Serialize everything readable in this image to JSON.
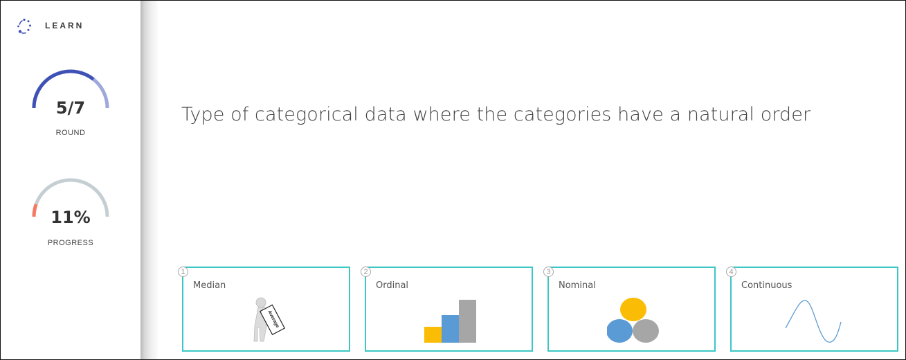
{
  "app": {
    "brand": "LEARN"
  },
  "round": {
    "value": "5/7",
    "label": "ROUND",
    "current": 5,
    "total": 7,
    "color": "#3f51b5",
    "color_light": "#9fa8da"
  },
  "progress": {
    "value": "11%",
    "label": "PROGRESS",
    "fraction": 0.11,
    "color": "#f47a64",
    "track_color": "#c5cfd3"
  },
  "question": {
    "text": "Type of categorical data where the categories have a natural order"
  },
  "options": [
    {
      "num": "1",
      "label": "Median",
      "image": "person-holding-average-sign-icon",
      "sign_text": "Average"
    },
    {
      "num": "2",
      "label": "Ordinal",
      "image": "ascending-bars-icon"
    },
    {
      "num": "3",
      "label": "Nominal",
      "image": "three-circles-icon"
    },
    {
      "num": "4",
      "label": "Continuous",
      "image": "sine-wave-icon"
    }
  ],
  "colors": {
    "accent": "#3cc6c6",
    "bar_yellow": "#fbbc05",
    "bar_blue": "#5b9bd5",
    "bar_gray": "#a6a6a6"
  }
}
